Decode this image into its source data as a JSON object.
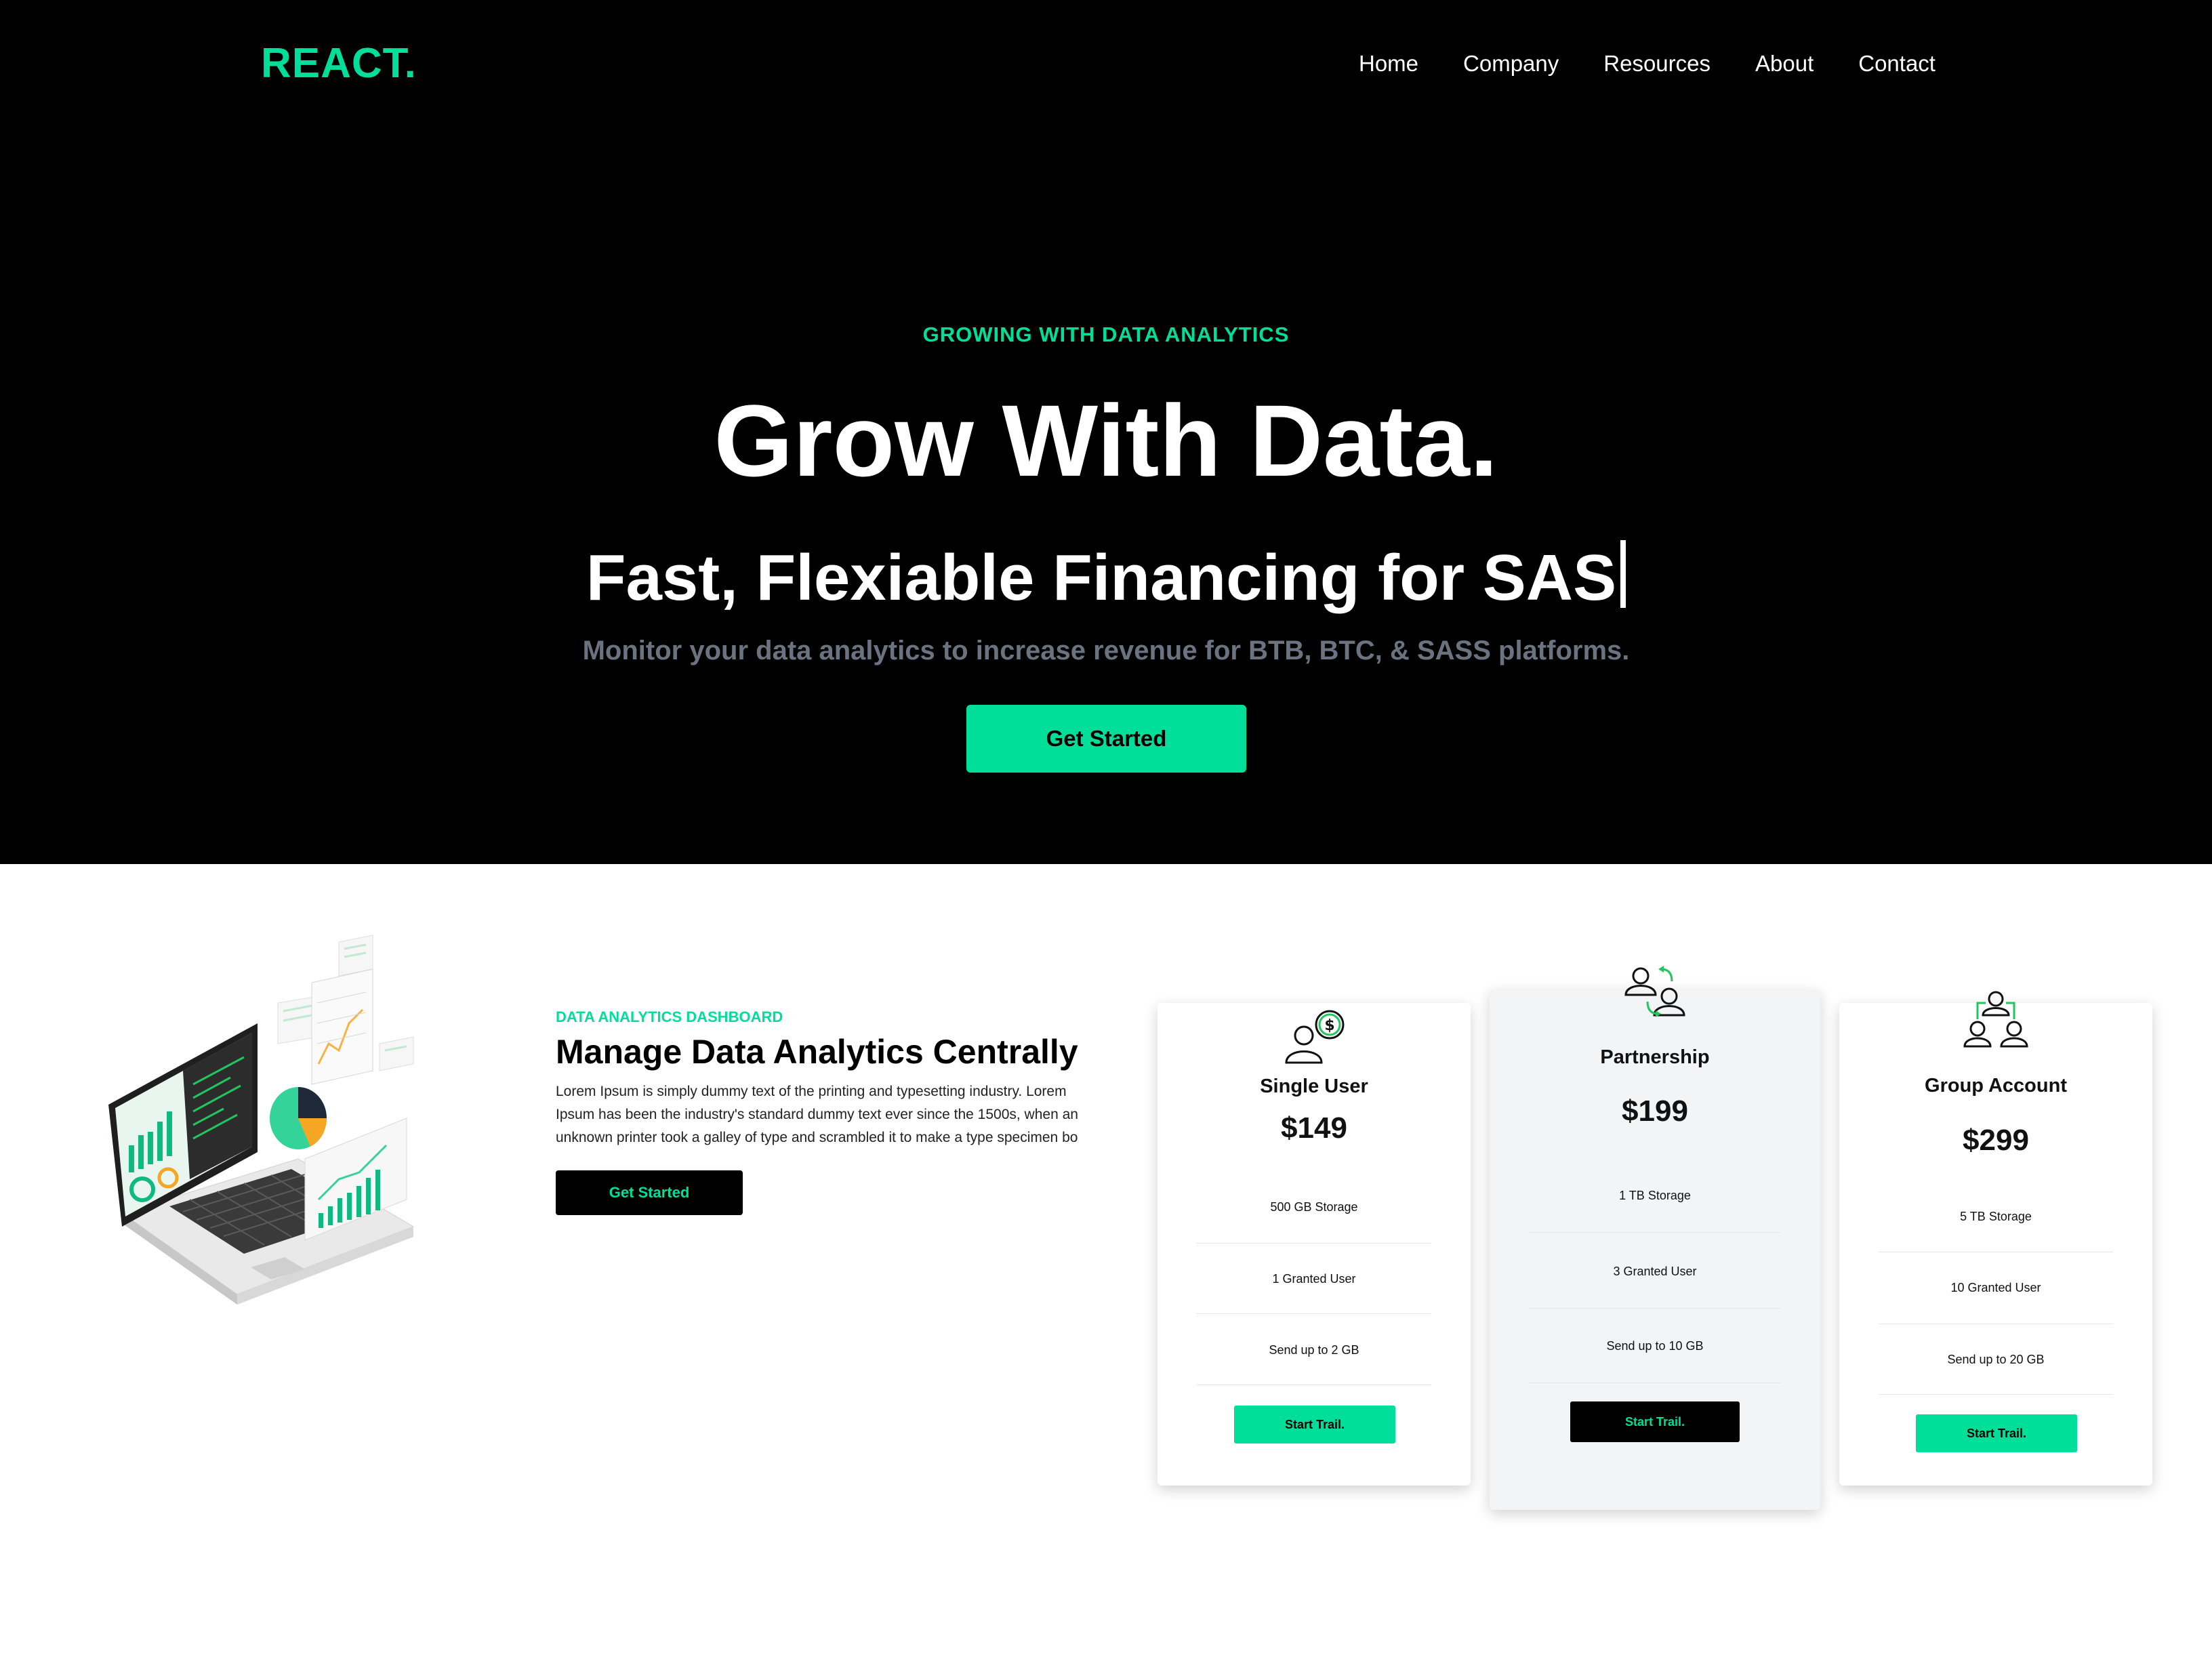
{
  "colors": {
    "accent": "#00df9a",
    "hero_bg": "#000000",
    "muted": "#6b7280"
  },
  "header": {
    "logo": "REACT.",
    "nav": [
      "Home",
      "Company",
      "Resources",
      "About",
      "Contact"
    ]
  },
  "hero": {
    "eyebrow": "GROWING WITH DATA ANALYTICS",
    "title": "Grow With Data.",
    "subtitle": "Fast, Flexiable Financing for SAS",
    "description": "Monitor your data analytics to increase revenue for BTB, BTC, & SASS platforms.",
    "cta": "Get Started"
  },
  "analytics": {
    "eyebrow": "DATA ANALYTICS DASHBOARD",
    "title": "Manage Data Analytics Centrally",
    "text": "Lorem Ipsum is simply dummy text of the printing and typesetting industry. Lorem Ipsum has been the industry's standard dummy text ever since the 1500s, when an unknown printer took a galley of type and scrambled it to make a type specimen bo",
    "cta": "Get Started",
    "illustration": "laptop-analytics-illustration"
  },
  "pricing": [
    {
      "name": "Single User",
      "price": "$149",
      "icon": "user-dollar-icon",
      "features": [
        "500 GB Storage",
        "1 Granted User",
        "Send up to 2 GB"
      ],
      "cta": "Start Trail."
    },
    {
      "name": "Partnership",
      "price": "$199",
      "icon": "partnership-icon",
      "features": [
        "1 TB Storage",
        "3 Granted User",
        "Send up to 10 GB"
      ],
      "cta": "Start Trail."
    },
    {
      "name": "Group Account",
      "price": "$299",
      "icon": "group-icon",
      "features": [
        "5 TB Storage",
        "10 Granted User",
        "Send up to 20 GB"
      ],
      "cta": "Start Trail."
    }
  ]
}
